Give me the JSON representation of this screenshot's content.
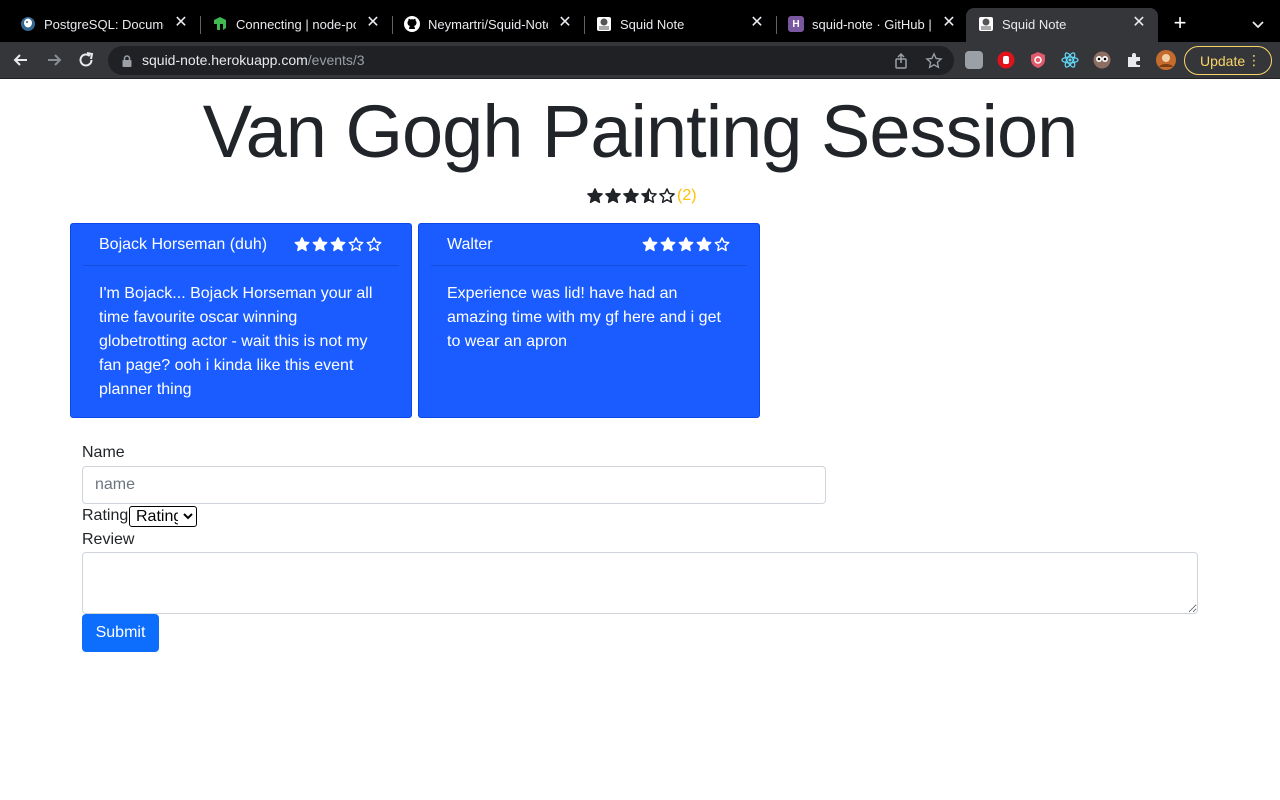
{
  "browser": {
    "tabs": [
      {
        "title": "PostgreSQL: Documen",
        "icon": "postgresql-icon",
        "active": false
      },
      {
        "title": "Connecting | node-po",
        "icon": "node-postgres-icon",
        "active": false
      },
      {
        "title": "Neymartri/Squid-Note",
        "icon": "github-icon",
        "active": false
      },
      {
        "title": "Squid Note",
        "icon": "squid-icon",
        "active": false
      },
      {
        "title": "squid-note · GitHub | H",
        "icon": "heroku-icon",
        "active": false
      },
      {
        "title": "Squid Note",
        "icon": "squid-icon",
        "active": true
      }
    ],
    "url_host": "squid-note.herokuapp.com",
    "url_path": "/events/3",
    "update_label": "Update",
    "colors": {
      "update": "#f9d46a"
    }
  },
  "event": {
    "title": "Van Gogh Painting Session",
    "avg_rating": 3.5,
    "rating_count": "(2)"
  },
  "reviews": [
    {
      "name": "Bojack Horseman (duh)",
      "rating": 3,
      "text": "I'm Bojack... Bojack Horseman your all time favourite oscar winning globetrotting actor - wait this is not my fan page? ooh i kinda like this event planner thing"
    },
    {
      "name": "Walter",
      "rating": 4,
      "text": "Experience was lid! have had an amazing time with my gf here and i get to wear an apron"
    }
  ],
  "form": {
    "name_label": "Name",
    "name_placeholder": "name",
    "rating_label": "Rating",
    "rating_selected": "Rating",
    "review_label": "Review",
    "submit_label": "Submit"
  },
  "colors": {
    "card": "#1a5cff",
    "button": "#0d6efd",
    "rating_count": "#ffc107"
  }
}
